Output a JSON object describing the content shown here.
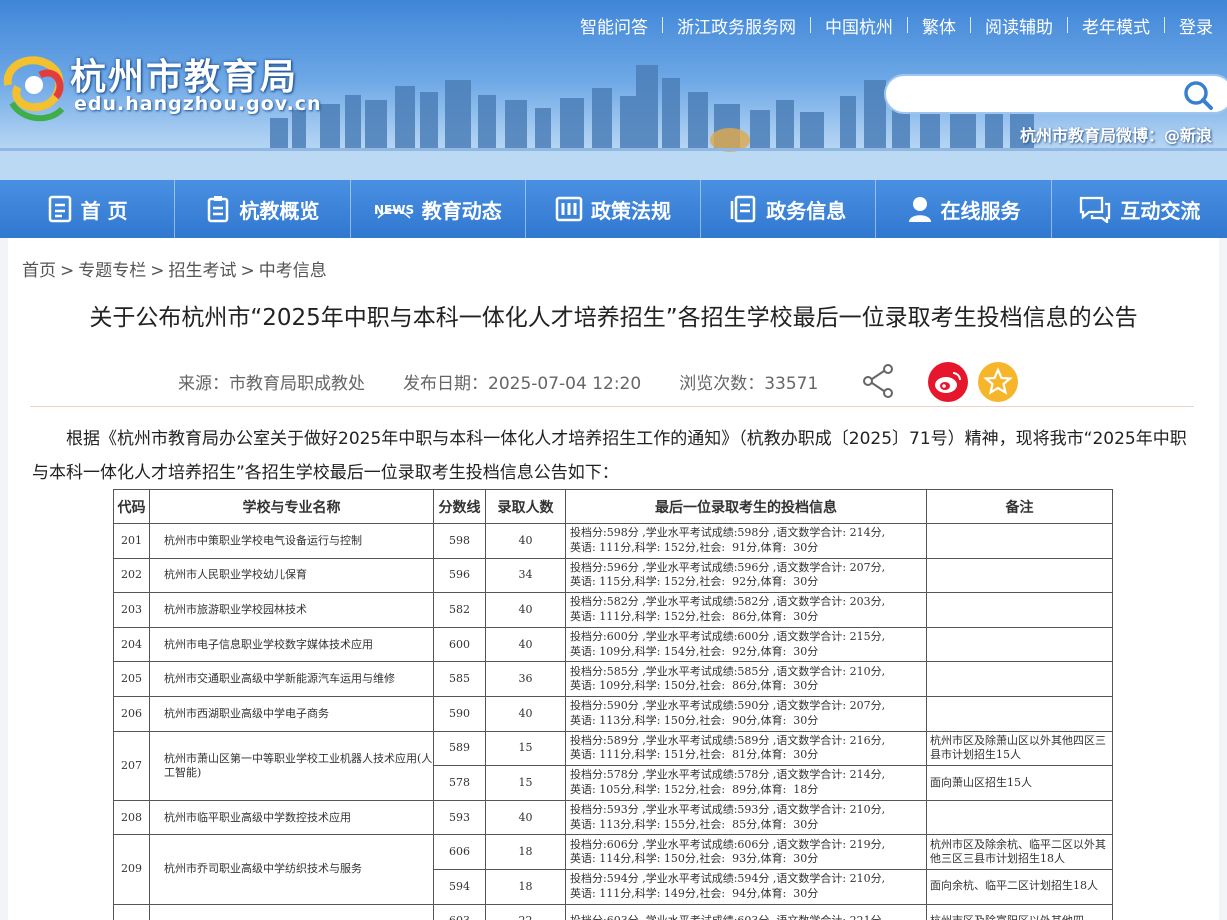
{
  "header": {
    "top_links": [
      "智能问答",
      "浙江政务服务网",
      "中国杭州",
      "繁体",
      "阅读辅助",
      "老年模式",
      "登录"
    ],
    "logo_title": "杭州市教育局",
    "logo_url": "edu.hangzhou.gov.cn",
    "search_placeholder": "",
    "weibo_text": "杭州市教育局微博：@新浪"
  },
  "nav": [
    {
      "label": "首 页",
      "icon": "document-icon"
    },
    {
      "label": "杭教概览",
      "icon": "clipboard-icon"
    },
    {
      "label": "教育动态",
      "icon": "news-icon"
    },
    {
      "label": "政策法规",
      "icon": "law-book-icon"
    },
    {
      "label": "政务信息",
      "icon": "info-doc-icon"
    },
    {
      "label": "在线服务",
      "icon": "user-service-icon"
    },
    {
      "label": "互动交流",
      "icon": "chat-icon"
    }
  ],
  "breadcrumb": [
    "首页",
    "专题专栏",
    "招生考试",
    "中考信息"
  ],
  "article": {
    "title": "关于公布杭州市“2025年中职与本科一体化人才培养招生”各招生学校最后一位录取考生投档信息的公告",
    "source": "来源：市教育局职成教处",
    "date": "发布日期：2025-07-04 12:20",
    "views": "浏览次数：33571",
    "body": "根据《杭州市教育局办公室关于做好2025年中职与本科一体化人才培养招生工作的通知》（杭教办职成〔2025〕71号）精神，现将我市“2025年中职与本科一体化人才培养招生”各招生学校最后一位录取考生投档信息公告如下："
  },
  "table": {
    "headers": [
      "代码",
      "学校与专业名称",
      "分数线",
      "录取人数",
      "最后一位录取考生的投档信息",
      "备注"
    ],
    "rows": [
      {
        "code": "201",
        "name": "杭州市中策职业学校电气设备运行与控制",
        "score": "598",
        "count": "40",
        "info": "投档分:598分 ,学业水平考试成绩:598分 ,语文数学合计: 214分,\n英语: 111分,科学: 152分,社会:  91分,体育:  30分",
        "note": ""
      },
      {
        "code": "202",
        "name": "杭州市人民职业学校幼儿保育",
        "score": "596",
        "count": "34",
        "info": "投档分:596分 ,学业水平考试成绩:596分 ,语文数学合计: 207分,\n英语: 115分,科学: 152分,社会:  92分,体育:  30分",
        "note": ""
      },
      {
        "code": "203",
        "name": "杭州市旅游职业学校园林技术",
        "score": "582",
        "count": "40",
        "info": "投档分:582分 ,学业水平考试成绩:582分 ,语文数学合计: 203分,\n英语: 111分,科学: 152分,社会:  86分,体育:  30分",
        "note": ""
      },
      {
        "code": "204",
        "name": "杭州市电子信息职业学校数字媒体技术应用",
        "score": "600",
        "count": "40",
        "info": "投档分:600分 ,学业水平考试成绩:600分 ,语文数学合计: 215分,\n英语: 109分,科学: 154分,社会:  92分,体育:  30分",
        "note": ""
      },
      {
        "code": "205",
        "name": "杭州市交通职业高级中学新能源汽车运用与维修",
        "score": "585",
        "count": "36",
        "info": "投档分:585分 ,学业水平考试成绩:585分 ,语文数学合计: 210分,\n英语: 109分,科学: 150分,社会:  86分,体育:  30分",
        "note": ""
      },
      {
        "code": "206",
        "name": "杭州市西湖职业高级中学电子商务",
        "score": "590",
        "count": "40",
        "info": "投档分:590分 ,学业水平考试成绩:590分 ,语文数学合计: 207分,\n英语: 113分,科学: 150分,社会:  90分,体育:  30分",
        "note": ""
      }
    ],
    "row207": {
      "code": "207",
      "name": "杭州市萧山区第一中等职业学校工业机器人技术应用(人工智能)",
      "sub": [
        {
          "score": "589",
          "count": "15",
          "info": "投档分:589分 ,学业水平考试成绩:589分 ,语文数学合计: 216分,\n英语: 111分,科学: 151分,社会:  81分,体育:  30分",
          "note": "杭州市区及除萧山区以外其他四区三县市计划招生15人"
        },
        {
          "score": "578",
          "count": "15",
          "info": "投档分:578分 ,学业水平考试成绩:578分 ,语文数学合计: 214分,\n英语: 105分,科学: 152分,社会:  89分,体育:  18分",
          "note": "面向萧山区招生15人"
        }
      ]
    },
    "row208": {
      "code": "208",
      "name": "杭州市临平职业高级中学数控技术应用",
      "score": "593",
      "count": "40",
      "info": "投档分:593分 ,学业水平考试成绩:593分 ,语文数学合计: 210分,\n英语: 113分,科学: 155分,社会:  85分,体育:  30分",
      "note": ""
    },
    "row209": {
      "code": "209",
      "name": "杭州市乔司职业高级中学纺织技术与服务",
      "sub": [
        {
          "score": "606",
          "count": "18",
          "info": "投档分:606分 ,学业水平考试成绩:606分 ,语文数学合计: 219分,\n英语: 114分,科学: 150分,社会:  93分,体育:  30分",
          "note": "杭州市区及除余杭、临平二区以外其他三区三县市计划招生18人"
        },
        {
          "score": "594",
          "count": "18",
          "info": "投档分:594分 ,学业水平考试成绩:594分 ,语文数学合计: 210分,\n英语: 111分,科学: 149分,社会:  94分,体育:  30分",
          "note": "面向余杭、临平二区计划招生18人"
        }
      ]
    },
    "row210": {
      "code": "",
      "name": "",
      "score": "603",
      "count": "22",
      "info": "投档分:603分 ,学业水平考试成绩:603分 ,语文数学合计: 221分,",
      "note": "杭州市区及除富阳区以外其他四"
    }
  }
}
